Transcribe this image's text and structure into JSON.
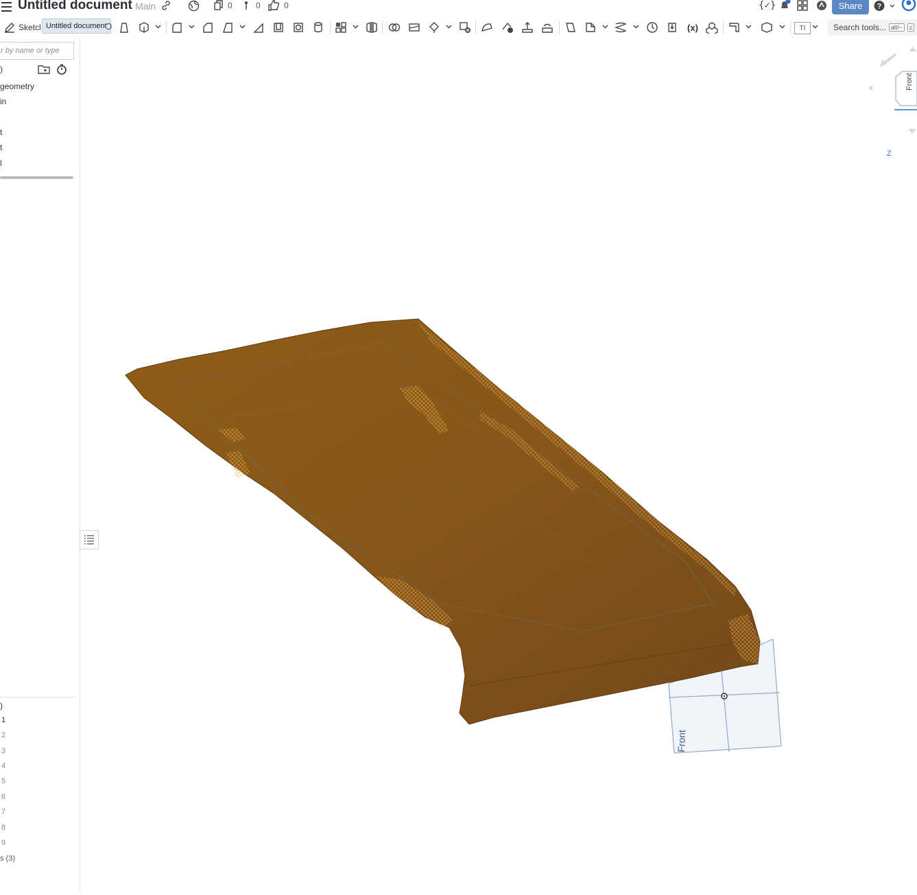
{
  "header": {
    "title": "Untitled document",
    "branch": "Main",
    "versions_count": "0",
    "branches_count": "0",
    "likes_count": "0",
    "share_label": "Share"
  },
  "toolbar": {
    "sketch_label": "Sketcl",
    "tooltip": "Untitled document",
    "search_label": "Search tools...",
    "search_shortcut": "alt/~",
    "search_shortcut2": "c",
    "fx_label": "(x)",
    "text_tool_label": "TI"
  },
  "feature_list": {
    "filter_placeholder": "r by name or type",
    "header_suffix": ")",
    "items": [
      "geometry",
      "in",
      "t",
      "t",
      "l"
    ]
  },
  "parts_list": {
    "header": ")",
    "numbers": [
      "1",
      "2",
      "3",
      "4",
      "5",
      "6",
      "7",
      "8",
      "9"
    ],
    "footer": "s (3)"
  },
  "viewport": {
    "model_color": "#8a5a14",
    "plane_label": "Front",
    "viewcube_face": "Front",
    "axis_label": "Z"
  },
  "colors": {
    "accent": "#5a87c6",
    "plane": "#6b8fb8",
    "highlight": "#e39a2a"
  }
}
